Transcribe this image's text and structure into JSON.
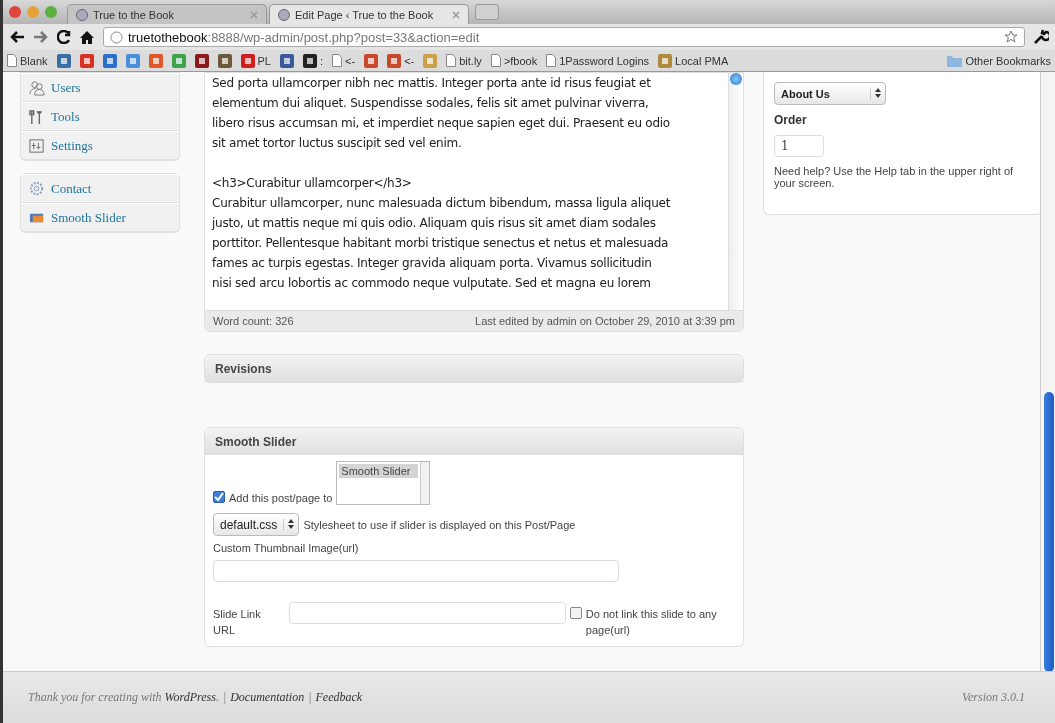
{
  "browser": {
    "tabs": [
      {
        "title": "True to the Book",
        "selected": false
      },
      {
        "title": "Edit Page ‹ True to the Book",
        "selected": true
      }
    ],
    "url": {
      "host": "truetothebook",
      "rest": ":8888/wp-admin/post.php?post=33&action=edit"
    },
    "bookmarks": [
      {
        "kind": "page",
        "label": "Blank"
      },
      {
        "kind": "app",
        "color": "#3b6ea5"
      },
      {
        "kind": "app",
        "color": "#d93025"
      },
      {
        "kind": "app",
        "color": "#2a6fc9"
      },
      {
        "kind": "app",
        "color": "#4a90d9"
      },
      {
        "kind": "app",
        "color": "#e0582a"
      },
      {
        "kind": "app",
        "color": "#3fa34d"
      },
      {
        "kind": "app",
        "color": "#8b1a1a"
      },
      {
        "kind": "app",
        "color": "#6b5a3a"
      },
      {
        "kind": "app",
        "color": "#d11f1f",
        "label": "PL"
      },
      {
        "kind": "app",
        "color": "#3b5998"
      },
      {
        "kind": "app",
        "color": "#222222",
        "label": ":"
      },
      {
        "kind": "page",
        "label": "<-"
      },
      {
        "kind": "app",
        "color": "#c8482a"
      },
      {
        "kind": "app",
        "color": "#c8482a",
        "label": "<-"
      },
      {
        "kind": "app",
        "color": "#c9a14a"
      },
      {
        "kind": "page",
        "label": "bit.ly"
      },
      {
        "kind": "page",
        "label": ">fbook"
      },
      {
        "kind": "page",
        "label": "1Password Logins"
      },
      {
        "kind": "app",
        "color": "#b08a3c",
        "label": "Local PMA"
      },
      {
        "kind": "folder",
        "label": "Other Bookmarks"
      }
    ]
  },
  "sidebar": {
    "groups": [
      [
        {
          "kind": "users",
          "label": "Users"
        },
        {
          "kind": "tools",
          "label": "Tools"
        },
        {
          "kind": "settings",
          "label": "Settings"
        }
      ],
      [
        {
          "kind": "contact",
          "label": "Contact"
        },
        {
          "kind": "slider",
          "label": "Smooth Slider"
        }
      ]
    ]
  },
  "editor": {
    "paragraphs": [
      [
        "Sed porta ullamcorper nibh nec mattis. Integer porta ante id risus feugiat et",
        "elementum dui aliquet. Suspendisse sodales, felis sit amet pulvinar viverra,",
        "libero risus accumsan mi, et imperdiet neque sapien eget dui. Praesent eu odio",
        "sit amet tortor luctus suscipit sed vel enim."
      ],
      [
        "<h3>Curabitur ullamcorper</h3>",
        "Curabitur ullamcorper, nunc malesuada dictum bibendum, massa ligula aliquet",
        "justo, ut mattis neque mi quis odio. Aliquam quis risus sit amet diam sodales",
        "porttitor. Pellentesque habitant morbi tristique senectus et netus et malesuada",
        "fames ac turpis egestas. Integer gravida aliquam porta. Vivamus sollicitudin",
        "nisi sed arcu lobortis ac commodo neque vulputate. Sed et magna eu lorem"
      ]
    ],
    "word_count": "Word count: 326",
    "last_edited": "Last edited by admin on October 29, 2010 at 3:39 pm"
  },
  "revisions": {
    "title": "Revisions"
  },
  "smooth_slider": {
    "title": "Smooth Slider",
    "add": {
      "checked": true,
      "label": "Add this post/page to"
    },
    "sliders": [
      {
        "label": "Smooth Slider",
        "selected": true
      }
    ],
    "stylesheet": {
      "value": "default.css",
      "label": "Stylesheet to use if slider is displayed on this Post/Page"
    },
    "thumbnail_label": "Custom Thumbnail Image(url)",
    "link_label": "Slide Link URL",
    "no_link": {
      "checked": false,
      "label": "Do not link this slide to any page(url)"
    }
  },
  "attributes": {
    "parent": "About Us",
    "order_label": "Order",
    "order": "1",
    "help": "Need help? Use the Help tab in the upper right of your screen."
  },
  "footer": {
    "thanks": "Thank you for creating with",
    "wordpress": "WordPress",
    "period": ".",
    "sep": "|",
    "documentation": "Documentation",
    "feedback": "Feedback",
    "version": "Version 3.0.1"
  }
}
